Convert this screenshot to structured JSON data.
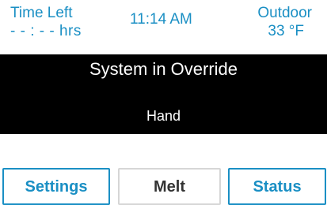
{
  "header": {
    "time_left_label": "Time Left",
    "time_left_value": "- - : - - hrs",
    "clock": "11:14 AM",
    "outdoor_label": "Outdoor",
    "outdoor_value": "33 °F"
  },
  "banner": {
    "title": "System in Override",
    "mode": "Hand"
  },
  "buttons": {
    "settings": "Settings",
    "melt": "Melt",
    "status": "Status"
  },
  "colors": {
    "accent": "#1a8fc4",
    "banner_bg": "#000000",
    "banner_text": "#ffffff",
    "inactive_border": "#d6d6d6"
  }
}
